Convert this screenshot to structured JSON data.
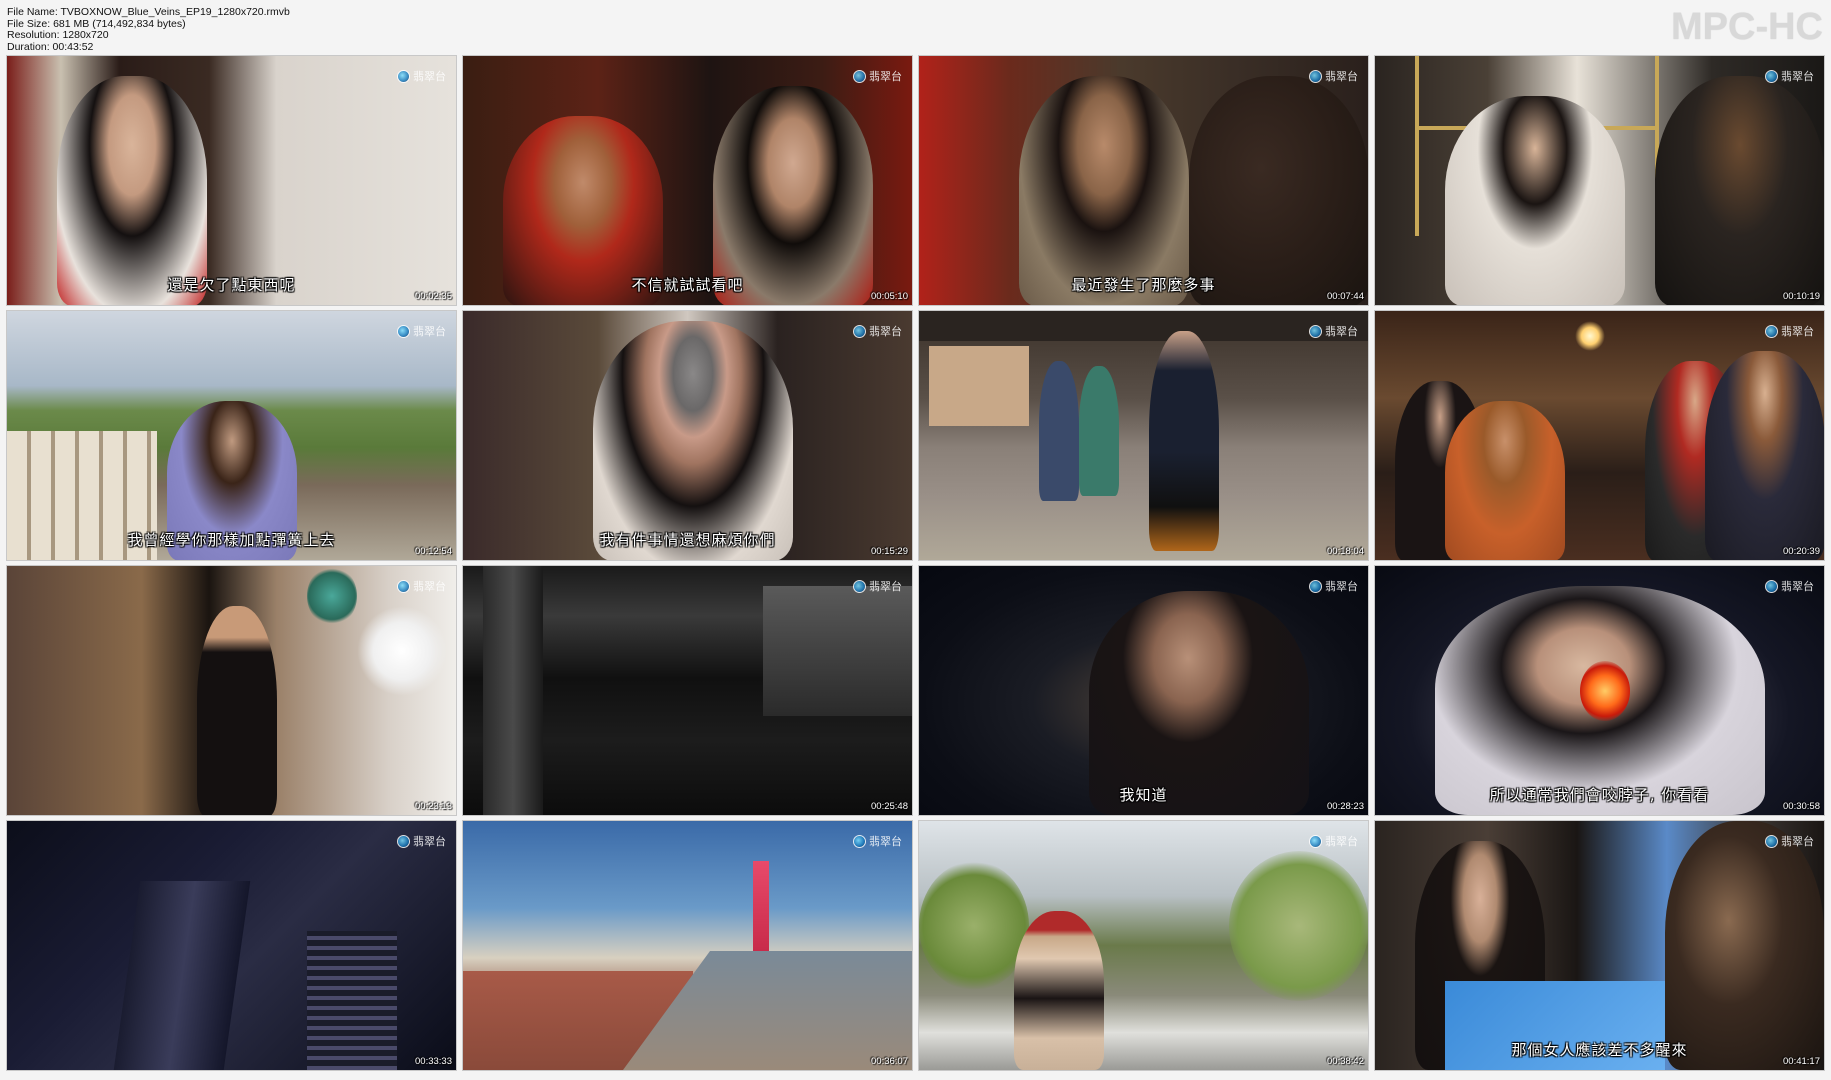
{
  "header": {
    "file_name": "File Name: TVBOXNOW_Blue_Veins_EP19_1280x720.rmvb",
    "file_size": "File Size: 681 MB (714,492,834 bytes)",
    "resolution": "Resolution: 1280x720",
    "duration": "Duration: 00:43:52"
  },
  "logo": "MPC-HC",
  "channel_logo_text": "翡翠台",
  "thumbnails": [
    {
      "subtitle": "還是欠了點東西呢",
      "timestamp": "00:02:35",
      "channel": "翡翠台"
    },
    {
      "subtitle": "不信就試試看吧",
      "timestamp": "00:05:10",
      "channel": "翡翠台"
    },
    {
      "subtitle": "最近發生了那麼多事",
      "timestamp": "00:07:44",
      "channel": "翡翠台"
    },
    {
      "subtitle": "",
      "timestamp": "00:10:19",
      "channel": "翡翠台"
    },
    {
      "subtitle": "我曾經學你那樣加點彈簧上去",
      "timestamp": "00:12:54",
      "channel": "翡翠台"
    },
    {
      "subtitle": "我有件事情還想麻煩你們",
      "timestamp": "00:15:29",
      "channel": "翡翠台"
    },
    {
      "subtitle": "",
      "timestamp": "00:18:04",
      "channel": "翡翠台"
    },
    {
      "subtitle": "",
      "timestamp": "00:20:39",
      "channel": "翡翠台"
    },
    {
      "subtitle": "",
      "timestamp": "00:23:13",
      "channel": "翡翠台"
    },
    {
      "subtitle": "",
      "timestamp": "00:25:48",
      "channel": "翡翠台"
    },
    {
      "subtitle": "我知道",
      "timestamp": "00:28:23",
      "channel": "翡翠台"
    },
    {
      "subtitle": "所以通常我們會咬脖子, 你看看",
      "timestamp": "00:30:58",
      "channel": "翡翠台"
    },
    {
      "subtitle": "",
      "timestamp": "00:33:33",
      "channel": "翡翠台"
    },
    {
      "subtitle": "",
      "timestamp": "00:36:07",
      "channel": "翡翠台"
    },
    {
      "subtitle": "",
      "timestamp": "00:38:42",
      "channel": "翡翠台"
    },
    {
      "subtitle": "那個女人應該差不多醒來",
      "timestamp": "00:41:17",
      "channel": "翡翠台"
    }
  ]
}
